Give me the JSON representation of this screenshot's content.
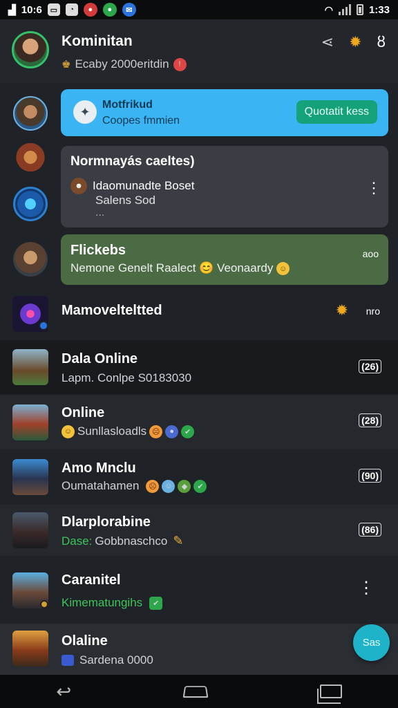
{
  "status_bar": {
    "left_text": "10:6",
    "chip_icons": [
      "notification-a-icon",
      "notification-b-icon",
      "messenger-icon"
    ],
    "time": "1:33"
  },
  "header": {
    "title": "Kominitan",
    "subtitle": "Ecaby 2000eritdin"
  },
  "promo_card": {
    "title": "Motfrikud",
    "subtitle": "Coopes fmmien",
    "button_label": "Quotatit kess"
  },
  "info_card": {
    "title": "Normnayás caeltes)",
    "line1": "Idaomunadte Boset",
    "line2": "Salens Sod",
    "line3": "..."
  },
  "highlight_card": {
    "title": "Flickebs",
    "subtitle": "Nemone Genelt Raalect 😊 Veonaardy",
    "meta": "aoo"
  },
  "rows": [
    {
      "title": "Mamovelteltted",
      "subtitle": "",
      "meta": "nro"
    },
    {
      "title": "Dala Online",
      "subtitle": "Lapm. Conlpe S0183030",
      "badge": "(26)"
    },
    {
      "title": "Online",
      "subtitle": "Sunllasloadls",
      "badge": "(28)"
    },
    {
      "title": "Amo Mnclu",
      "subtitle": "Oumatahamen",
      "badge": "(90)"
    },
    {
      "title": "Dlarplorabine",
      "subtitle": "Gobbnaschco",
      "subtitle_prefix": "Dase:",
      "badge": "(86)"
    },
    {
      "title": "Caranitel",
      "subtitle": "Kimematungihs"
    },
    {
      "title": "Olaline",
      "subtitle": "Sardena 0000"
    }
  ],
  "fab_label": "Sas",
  "colors": {
    "background": "#1f2226",
    "promo": "#3ab4f2",
    "promo_button": "#15a27a",
    "highlight": "#4a6b43",
    "accent_green": "#33c26a",
    "fab": "#1fb3c9"
  }
}
